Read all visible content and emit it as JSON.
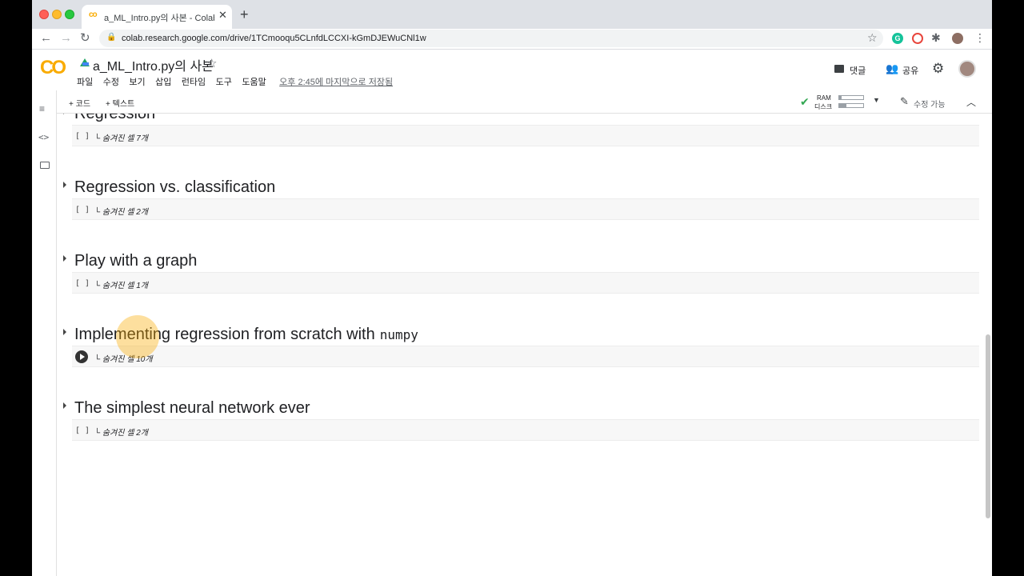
{
  "browser": {
    "tab_title": "a_ML_Intro.py의 사본 - Colabora",
    "tab_favicon": "co",
    "tab_close": "✕",
    "new_tab": "+",
    "url": "colab.research.google.com/drive/1TCmooqu5CLnfdLCCXI-kGmDJEWuCNl1w",
    "nav_back": "←",
    "nav_forward": "→",
    "nav_reload": "↻",
    "lock_icon": "🔒",
    "star_icon": "☆",
    "grammarly": "G",
    "puzzle_icon": "✱",
    "menu_icon": "⋮"
  },
  "colab": {
    "logo": "CO",
    "notebook_title": "a_ML_Intro.py의 사본",
    "star_icon": "☆",
    "menu": [
      "파일",
      "수정",
      "보기",
      "삽입",
      "런타임",
      "도구",
      "도움말"
    ],
    "saved_status": "오후 2:45에 마지막으로 저장됨",
    "comment_label": "댓글",
    "share_label": "공유",
    "share_icon": "👥",
    "settings_icon": "⚙"
  },
  "toolbar": {
    "add_code": "+ 코드",
    "add_text": "+ 텍스트",
    "ram_label": "RAM",
    "disk_label": "디스크",
    "ram_usage": 0.1,
    "disk_usage": 0.3,
    "check_icon": "✔",
    "dropdown_icon": "▼",
    "edit_icon": "✎",
    "edit_label": "수정 가능",
    "collapse_icon": "︿"
  },
  "rail": {
    "toc_icon": "≡",
    "code_icon": "<>"
  },
  "sections": [
    {
      "title": "Regression",
      "code": "",
      "cell_marker": "[ ]",
      "hidden_cells": "숨겨진 셀 7개"
    },
    {
      "title": "Regression vs. classification",
      "code": "",
      "cell_marker": "[ ]",
      "hidden_cells": "숨겨진 셀 2개"
    },
    {
      "title": "Play with a graph",
      "code": "",
      "cell_marker": "[ ]",
      "hidden_cells": "숨겨진 셀 1개"
    },
    {
      "title": "Implementing regression from scratch with",
      "code": "numpy",
      "cell_marker": "run",
      "hidden_cells": "숨겨진 셀 10개"
    },
    {
      "title": "The simplest neural network ever",
      "code": "",
      "cell_marker": "[ ]",
      "hidden_cells": "숨겨진 셀 2개"
    }
  ],
  "colors": {
    "accent": "#f9ab00",
    "check": "#34a853"
  }
}
